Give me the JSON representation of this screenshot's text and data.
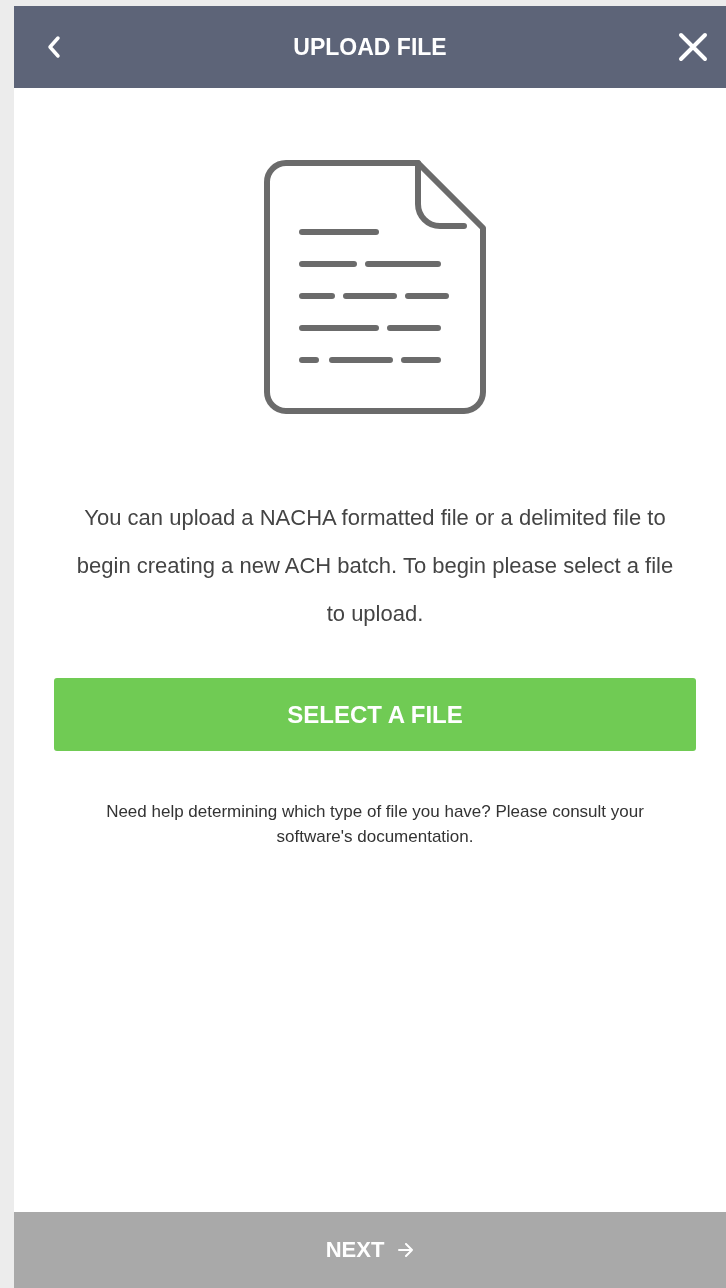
{
  "header": {
    "title": "UPLOAD FILE"
  },
  "intro": "You can upload a NACHA formatted file or a delimited file to begin creating a new ACH batch. To begin please select a file to upload.",
  "select_button": {
    "label": "SELECT A FILE"
  },
  "help": "Need help determining which type of file you have? Please consult your software's documentation.",
  "next_button": {
    "label": "NEXT",
    "disabled": true
  }
}
